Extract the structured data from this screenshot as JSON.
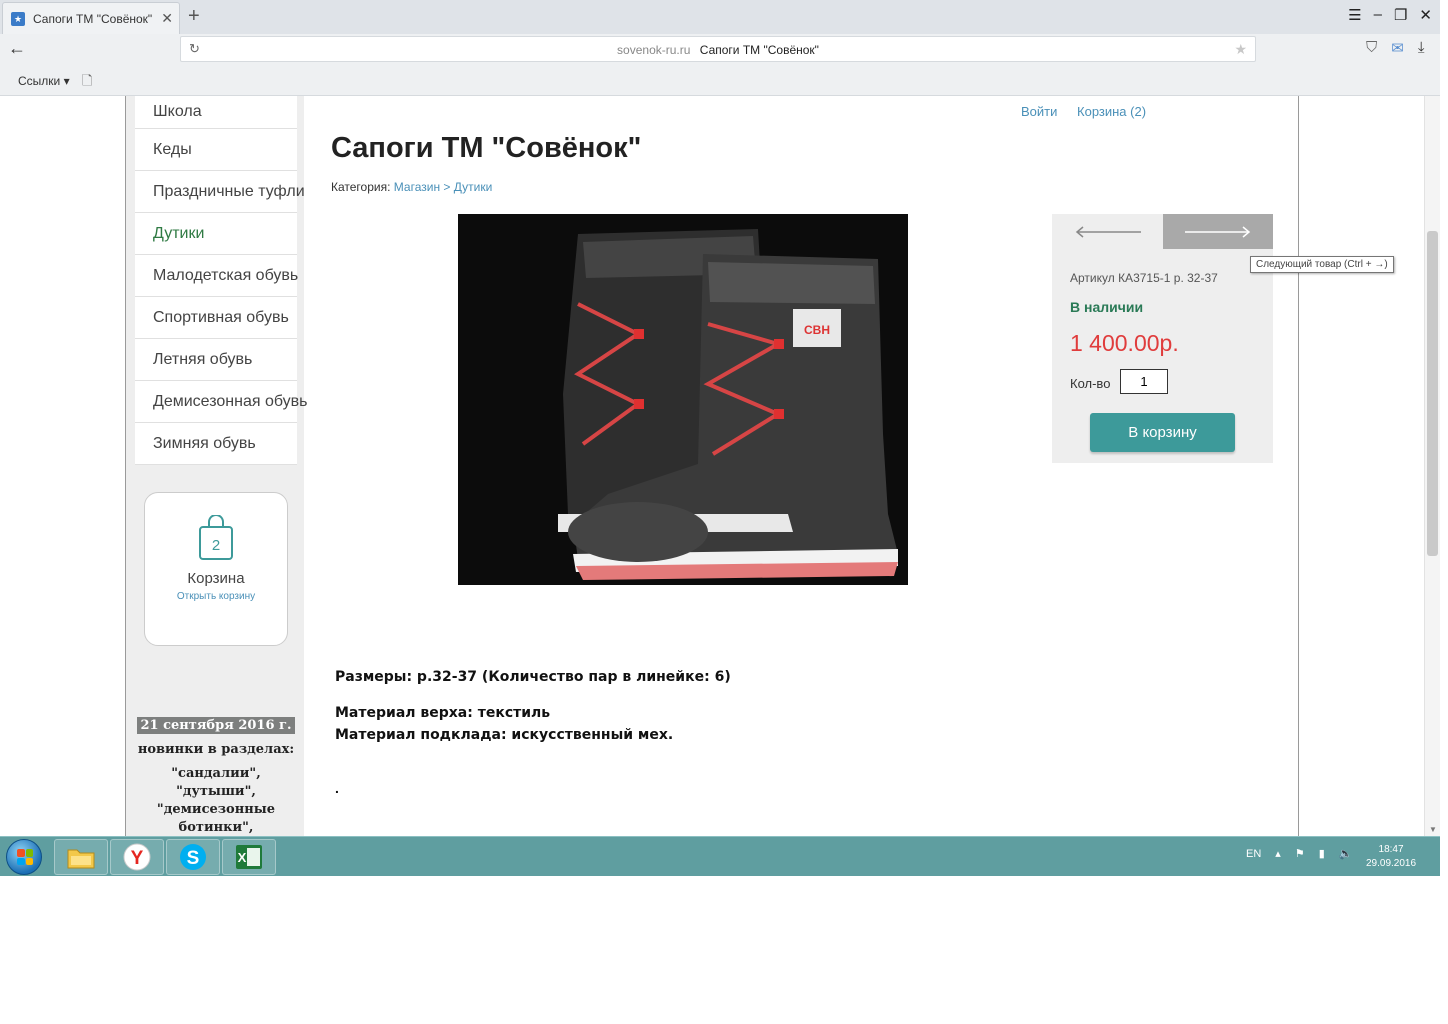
{
  "browser": {
    "tab_title": "Сапоги ТМ \"Совёнок\"",
    "url_domain": "sovenok-ru.ru",
    "url_title": "Сапоги ТМ \"Совёнок\"",
    "bookmarks_label": "Ссылки"
  },
  "sidebar": {
    "menu": [
      {
        "label": "Школа"
      },
      {
        "label": "Кеды"
      },
      {
        "label": "Праздничные туфли"
      },
      {
        "label": "Дутики"
      },
      {
        "label": "Малодетская обувь"
      },
      {
        "label": "Спортивная обувь"
      },
      {
        "label": "Летняя обувь"
      },
      {
        "label": "Демисезонная обувь"
      },
      {
        "label": "Зимняя обувь"
      }
    ],
    "cart": {
      "count": "2",
      "title": "Корзина",
      "link": "Открыть корзину"
    },
    "news": {
      "date": "21 сентября 2016 г.",
      "line": "новинки в разделах:",
      "body": "\"сандалии\", \"дутыши\", \"демисезонные ботинки\", \"праздничные туфли\","
    }
  },
  "header": {
    "login": "Войти",
    "cart_link": "Корзина (2)"
  },
  "product": {
    "title": "Сапоги ТМ \"Совёнок\"",
    "category_label": "Категория:",
    "crumb_shop": "Магазин",
    "crumb_sep": ">",
    "crumb_category": "Дутики",
    "sku": "Артикул КА3715-1 р. 32-37",
    "stock": "В наличии",
    "price": "1 400.00р.",
    "qty_label": "Кол-во",
    "qty_value": "1",
    "add_to_cart": "В корзину",
    "next_tooltip": "Следующий товар (Ctrl + →)",
    "desc_sizes": "Размеры: р.32-37 (Количество пар в линейке: 6)",
    "desc_upper": "Материал верха: текстиль",
    "desc_lining": "Материал подклада: искусственный мех.",
    "desc_end": "."
  },
  "taskbar": {
    "lang": "EN",
    "time": "18:47",
    "date": "29.09.2016"
  },
  "colors": {
    "accent_teal": "#3d9a9a",
    "price_red": "#e03c3c",
    "link_blue": "#4a90b8",
    "stock_green": "#2a7a56",
    "taskbar": "#5f9ea0"
  }
}
